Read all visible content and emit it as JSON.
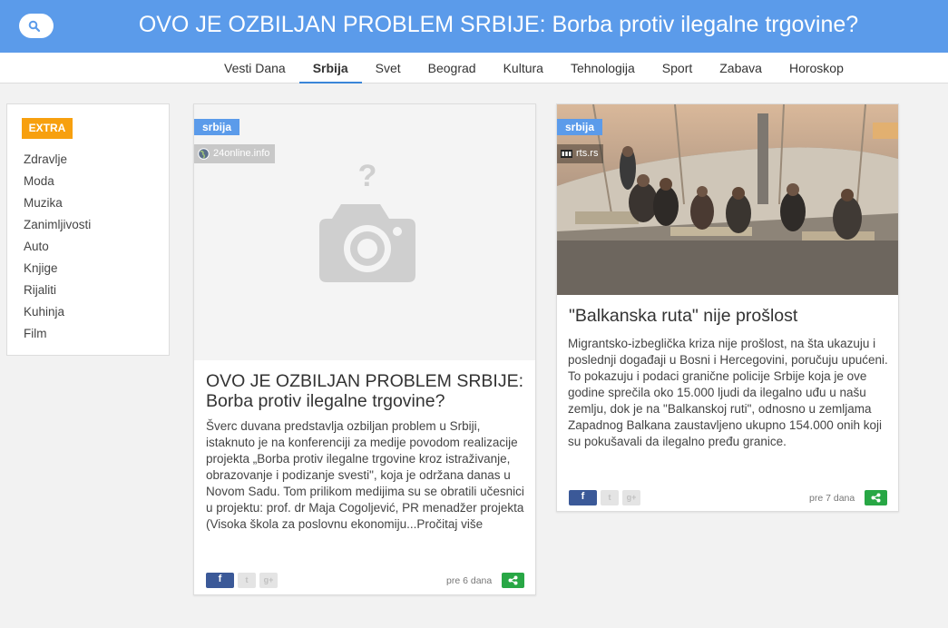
{
  "header": {
    "title": "OVO JE OZBILJAN PROBLEM SRBIJE: Borba protiv ilegalne trgovine?",
    "search_icon": "search-icon",
    "color": "#5b9bea"
  },
  "nav": {
    "items": [
      {
        "label": "Vesti Dana"
      },
      {
        "label": "Srbija",
        "active": true
      },
      {
        "label": "Svet"
      },
      {
        "label": "Beograd"
      },
      {
        "label": "Kultura"
      },
      {
        "label": "Tehnologija"
      },
      {
        "label": "Sport"
      },
      {
        "label": "Zabava"
      },
      {
        "label": "Horoskop"
      }
    ]
  },
  "sidebar": {
    "badge": "EXTRA",
    "badge_color": "#f7a00f",
    "items": [
      {
        "label": "Zdravlje"
      },
      {
        "label": "Moda"
      },
      {
        "label": "Muzika"
      },
      {
        "label": "Zanimljivosti"
      },
      {
        "label": "Auto"
      },
      {
        "label": "Knjige"
      },
      {
        "label": "Rijaliti"
      },
      {
        "label": "Kuhinja"
      },
      {
        "label": "Film"
      }
    ]
  },
  "articles": [
    {
      "category": "srbija",
      "source": "24online.info",
      "image": "camera-placeholder-icon",
      "title": "OVO JE OZBILJAN PROBLEM SRBIJE: Borba protiv ilegalne trgovine?",
      "body": "  Šverc  duvana predstavlja ozbiljan problem u Srbiji, istaknuto je na konferenciji za medije povodom realizacije projekta „Borba protiv ilegalne trgovine kroz istraživanje, obrazovanje i podizanje svesti\",  koja je održana danas u Novom Sadu.  Tom prilikom medijima su se obratili učesnici u projektu: prof. dr Maja Cogoljević, PR menadžer projekta (Visoka škola za poslovnu ekonomiju...Pročitaj više",
      "time": "pre 6 dana"
    },
    {
      "category": "srbija",
      "source": "rts.rs",
      "image": "migrant-tent-photo",
      "title": "\"Balkanska ruta\" nije prošlost",
      "body": "Migrantsko-izbeglička kriza nije prošlost, na šta ukazuju i poslednji događaji u Bosni i Hercegovini, poručuju upućeni. To pokazuju i podaci granične policije Srbije koja je ove godine sprečila oko 15.000 ljudi da ilegalno uđu u našu zemlju, dok je na \"Balkanskoj ruti\", odnosno u zemljama Zapadnog Balkana zaustavljeno ukupno 154.000 onih koji su pokušavali da ilegalno pređu granice.",
      "time": "pre 7 dana"
    }
  ],
  "social": {
    "facebook_icon": "f",
    "twitter_icon": "t",
    "googleplus_icon": "g+"
  }
}
